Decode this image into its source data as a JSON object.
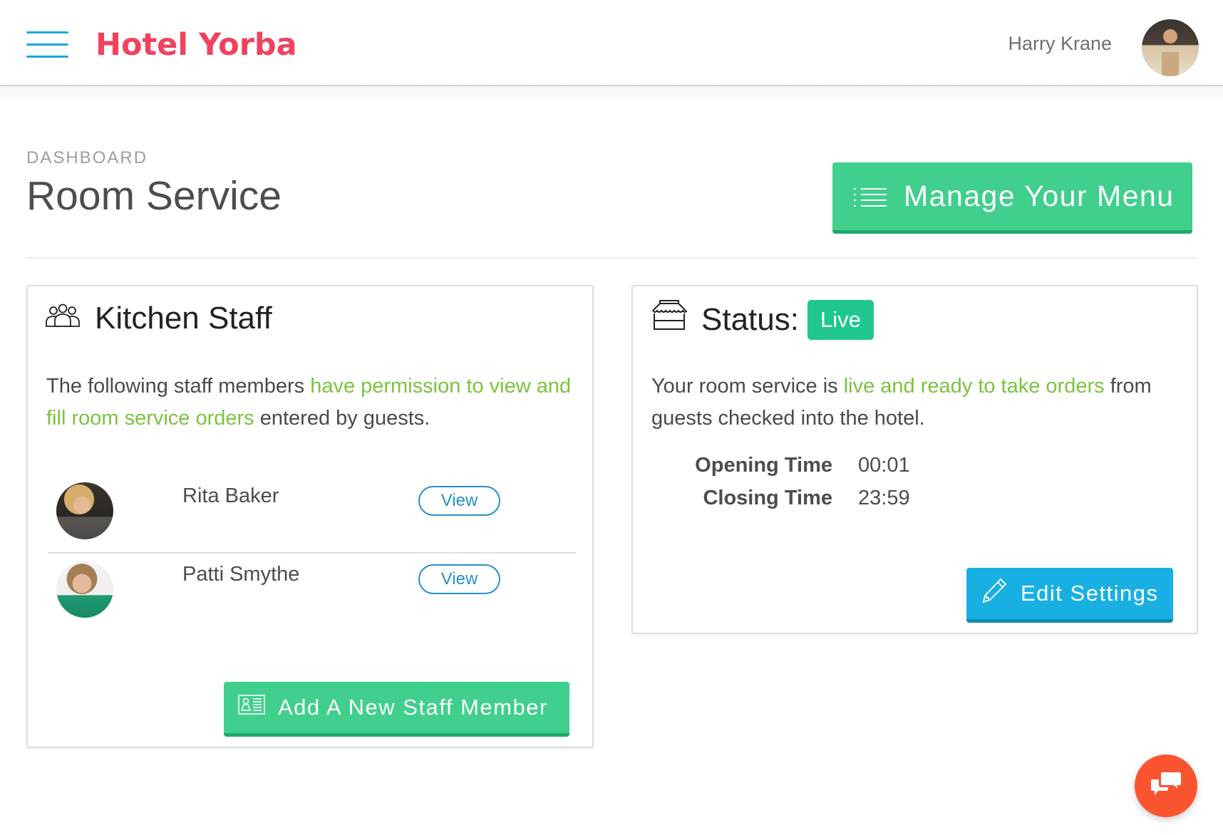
{
  "header": {
    "brand": "Hotel Yorba",
    "user_name": "Harry Krane",
    "icons": {
      "menu": "hamburger-icon",
      "avatar": "user-avatar"
    }
  },
  "page": {
    "breadcrumb": "DASHBOARD",
    "title": "Room Service",
    "manage_menu_label": "Manage Your Menu"
  },
  "kitchen_staff": {
    "title": "Kitchen Staff",
    "description": {
      "before": "The following staff members ",
      "highlight": "have permission to view and fill room service orders",
      "after": " entered by guests."
    },
    "staff": [
      {
        "name": "Rita Baker",
        "action_label": "View"
      },
      {
        "name": "Patti Smythe",
        "action_label": "View"
      }
    ],
    "add_label": "Add A New Staff Member"
  },
  "status": {
    "title": "Status:",
    "badge": "Live",
    "badge_color": "#1fc78f",
    "description": {
      "before": "Your room service is ",
      "highlight": "live and ready to take orders",
      "after": " from guests checked into the hotel."
    },
    "opening_label": "Opening Time",
    "opening_value": "00:01",
    "closing_label": "Closing Time",
    "closing_value": "23:59",
    "edit_label": "Edit Settings"
  },
  "colors": {
    "brand": "#f0425f",
    "primary_green": "#40cf8d",
    "primary_blue": "#18b0e3",
    "highlight_text": "#7cc33f",
    "chat_button": "#fb5430"
  }
}
